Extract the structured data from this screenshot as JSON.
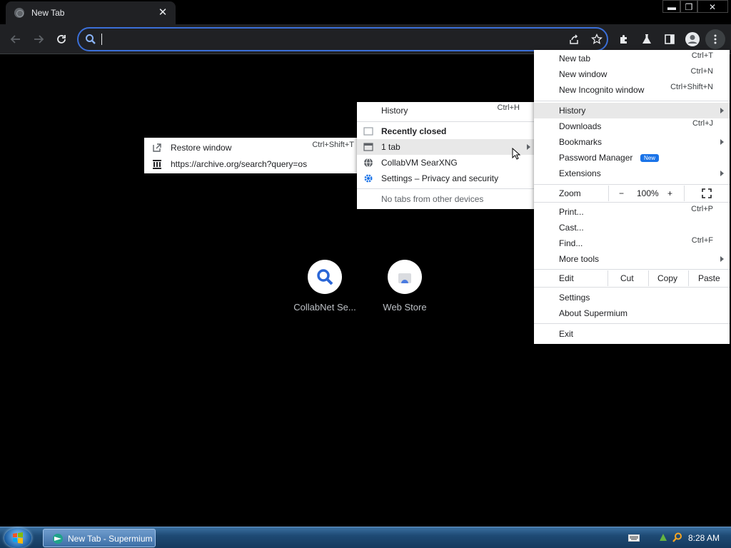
{
  "browser": {
    "tab_title": "New Tab",
    "window_controls": {
      "minimize": "▬",
      "restore": "❐",
      "close": "✕"
    }
  },
  "toolbar": {
    "omnibox_value": ""
  },
  "ntp": {
    "tiles": [
      {
        "label": "CollabNet Se..."
      },
      {
        "label": "Web Store"
      }
    ]
  },
  "main_menu": {
    "new_tab": {
      "label": "New tab",
      "shortcut": "Ctrl+T"
    },
    "new_window": {
      "label": "New window",
      "shortcut": "Ctrl+N"
    },
    "new_incognito": {
      "label": "New Incognito window",
      "shortcut": "Ctrl+Shift+N"
    },
    "history": {
      "label": "History"
    },
    "downloads": {
      "label": "Downloads",
      "shortcut": "Ctrl+J"
    },
    "bookmarks": {
      "label": "Bookmarks"
    },
    "password_manager": {
      "label": "Password Manager",
      "badge": "New"
    },
    "extensions": {
      "label": "Extensions"
    },
    "zoom": {
      "label": "Zoom",
      "minus": "−",
      "value": "100%",
      "plus": "+"
    },
    "print": {
      "label": "Print...",
      "shortcut": "Ctrl+P"
    },
    "cast": {
      "label": "Cast..."
    },
    "find": {
      "label": "Find...",
      "shortcut": "Ctrl+F"
    },
    "more_tools": {
      "label": "More tools"
    },
    "edit": {
      "label": "Edit",
      "cut": "Cut",
      "copy": "Copy",
      "paste": "Paste"
    },
    "settings": {
      "label": "Settings"
    },
    "about": {
      "label": "About Supermium"
    },
    "exit": {
      "label": "Exit"
    }
  },
  "history_menu": {
    "history": {
      "label": "History",
      "shortcut": "Ctrl+H"
    },
    "recently_closed": "Recently closed",
    "one_tab": "1 tab",
    "collabvm": "CollabVM SearXNG",
    "settings_privacy": "Settings – Privacy and security",
    "no_tabs": "No tabs from other devices"
  },
  "tab_submenu": {
    "restore_window": {
      "label": "Restore window",
      "shortcut": "Ctrl+Shift+T"
    },
    "archive_url": "https://archive.org/search?query=os"
  },
  "taskbar": {
    "task_label": "New Tab - Supermium",
    "clock": "8:28 AM"
  },
  "colors": {
    "accent": "#3b6fd8",
    "toolbar_bg": "#202124",
    "menu_highlight": "#e8e8e8",
    "new_badge": "#1a73e8"
  }
}
